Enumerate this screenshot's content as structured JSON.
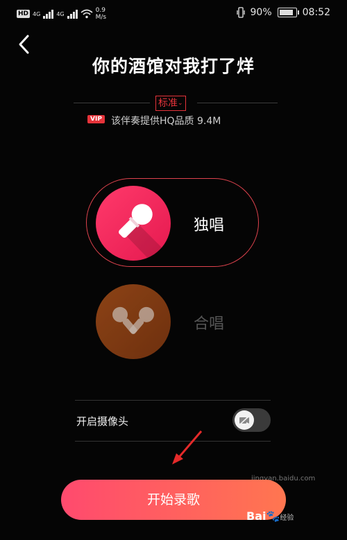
{
  "status_bar": {
    "hd_label": "HD",
    "net1": "4G",
    "net2": "4G",
    "speed_value": "0.9",
    "speed_unit": "M/s",
    "battery": "90%",
    "time": "08:52"
  },
  "header": {
    "title": "你的酒馆对我打了烊"
  },
  "quality": {
    "selected": "标准",
    "vip_badge": "VIP",
    "hint": "该伴奏提供HQ品质 9.4M"
  },
  "modes": {
    "solo_label": "独唱",
    "chorus_label": "合唱"
  },
  "camera": {
    "label": "开启摄像头",
    "enabled": false
  },
  "footer": {
    "start_label": "开始录歌",
    "watermark": "jingyan.baidu.com",
    "brand": "Bai",
    "brand_suffix": "经验"
  },
  "colors": {
    "accent": "#e6333a",
    "solo_gradient_start": "#ff3a6b",
    "button_gradient_end": "#ff7650"
  }
}
